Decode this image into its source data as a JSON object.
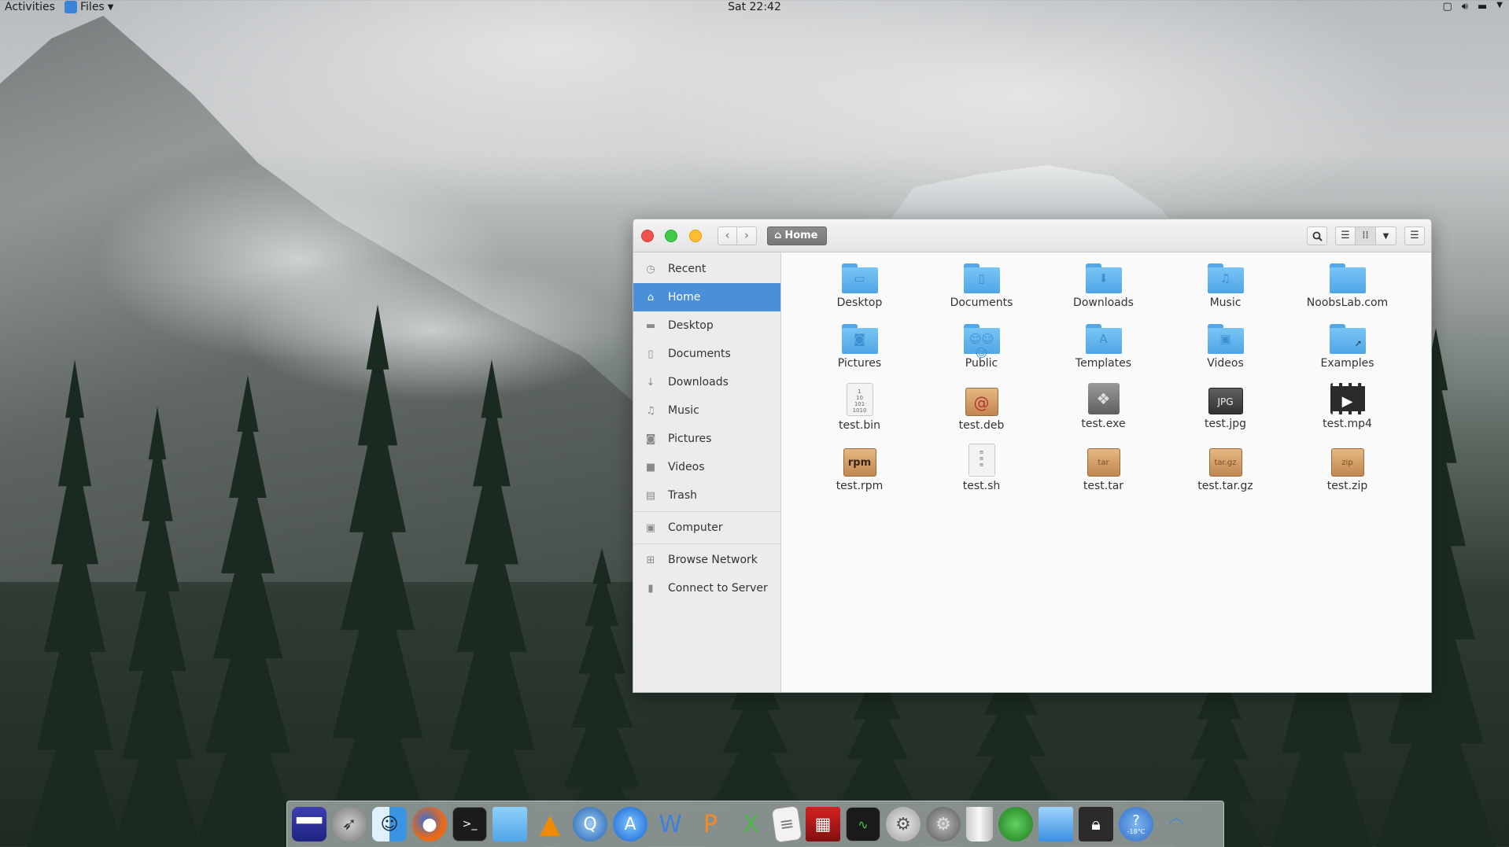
{
  "topbar": {
    "activities": "Activities",
    "app_name": "Files",
    "clock": "Sat 22:42"
  },
  "window": {
    "path_label": "Home",
    "back_glyph": "‹",
    "forward_glyph": "›"
  },
  "sidebar": {
    "items": [
      {
        "label": "Recent",
        "icon": "clock-icon"
      },
      {
        "label": "Home",
        "icon": "home-icon",
        "active": true
      },
      {
        "label": "Desktop",
        "icon": "desktop-icon"
      },
      {
        "label": "Documents",
        "icon": "document-icon"
      },
      {
        "label": "Downloads",
        "icon": "download-icon"
      },
      {
        "label": "Music",
        "icon": "music-icon"
      },
      {
        "label": "Pictures",
        "icon": "camera-icon"
      },
      {
        "label": "Videos",
        "icon": "video-icon"
      },
      {
        "label": "Trash",
        "icon": "trash-icon"
      },
      {
        "label": "Computer",
        "icon": "computer-icon"
      },
      {
        "label": "Browse Network",
        "icon": "network-icon"
      },
      {
        "label": "Connect to Server",
        "icon": "server-icon"
      }
    ]
  },
  "files": [
    {
      "name": "Desktop",
      "kind": "folder"
    },
    {
      "name": "Documents",
      "kind": "folder"
    },
    {
      "name": "Downloads",
      "kind": "folder"
    },
    {
      "name": "Music",
      "kind": "folder"
    },
    {
      "name": "NoobsLab.com",
      "kind": "folder"
    },
    {
      "name": "Pictures",
      "kind": "folder"
    },
    {
      "name": "Public",
      "kind": "folder"
    },
    {
      "name": "Templates",
      "kind": "folder"
    },
    {
      "name": "Videos",
      "kind": "folder"
    },
    {
      "name": "Examples",
      "kind": "folder-link"
    },
    {
      "name": "test.bin",
      "kind": "binary-file"
    },
    {
      "name": "test.deb",
      "kind": "deb-package"
    },
    {
      "name": "test.exe",
      "kind": "executable-file"
    },
    {
      "name": "test.jpg",
      "kind": "image-file",
      "badge": "JPG"
    },
    {
      "name": "test.mp4",
      "kind": "video-file"
    },
    {
      "name": "test.rpm",
      "kind": "rpm-package",
      "badge": "rpm"
    },
    {
      "name": "test.sh",
      "kind": "script-file"
    },
    {
      "name": "test.tar",
      "kind": "tar-archive",
      "badge": "tar"
    },
    {
      "name": "test.tar.gz",
      "kind": "targz-archive",
      "badge": "tar.gz"
    },
    {
      "name": "test.zip",
      "kind": "zip-archive",
      "badge": "zip"
    }
  ],
  "dock": {
    "weather_text": "-18°C",
    "items": [
      "screen-keyboard",
      "launchpad",
      "finder",
      "firefox",
      "terminal",
      "files",
      "vlc",
      "network-browser",
      "app-store",
      "libreoffice-writer",
      "libreoffice-impress",
      "libreoffice-calc",
      "text-editor",
      "video-editor",
      "system-monitor",
      "disk-utility",
      "system-settings",
      "trash",
      "world-clock",
      "desktop",
      "lock-screen",
      "help",
      "wifi"
    ]
  }
}
